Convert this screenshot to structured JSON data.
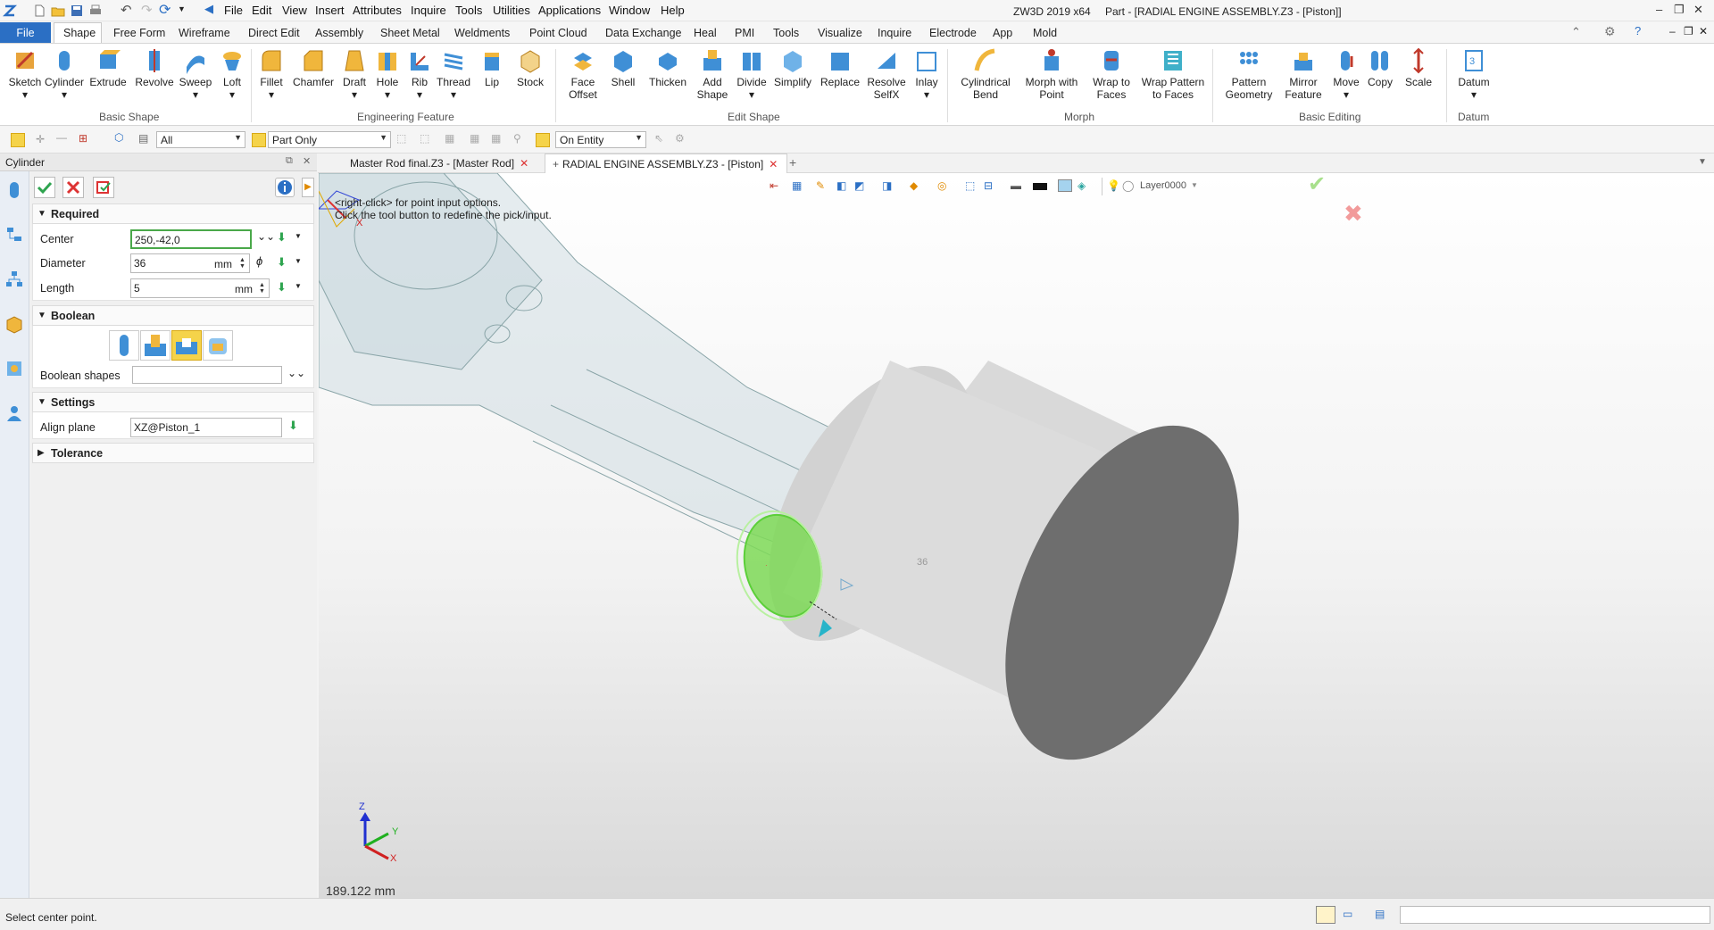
{
  "menu": [
    "File",
    "Edit",
    "View",
    "Insert",
    "Attributes",
    "Inquire",
    "Tools",
    "Utilities",
    "Applications",
    "Window",
    "Help"
  ],
  "app_title": "ZW3D 2019  x64",
  "doc_title": "Part - [RADIAL ENGINE ASSEMBLY.Z3 - [Piston]]",
  "ribbon_tabs": [
    "File",
    "Shape",
    "Free Form",
    "Wireframe",
    "Direct Edit",
    "Assembly",
    "Sheet Metal",
    "Weldments",
    "Point Cloud",
    "Data Exchange",
    "Heal",
    "PMI",
    "Tools",
    "Visualize",
    "Inquire",
    "Electrode",
    "App",
    "Mold"
  ],
  "ribbon": {
    "basic_shape": {
      "label": "Basic Shape",
      "buttons": [
        "Sketch",
        "Cylinder",
        "Extrude",
        "Revolve",
        "Sweep",
        "Loft"
      ]
    },
    "engineering_feature": {
      "label": "Engineering Feature",
      "buttons": [
        "Fillet",
        "Chamfer",
        "Draft",
        "Hole",
        "Rib",
        "Thread",
        "Lip",
        "Stock"
      ]
    },
    "edit_shape": {
      "label": "Edit Shape",
      "buttons": [
        "Face\nOffset",
        "Shell",
        "Thicken",
        "Add\nShape",
        "Divide",
        "Simplify",
        "Replace",
        "Resolve\nSelfX",
        "Inlay"
      ]
    },
    "morph": {
      "label": "Morph",
      "buttons": [
        "Cylindrical\nBend",
        "Morph with\nPoint",
        "Wrap to\nFaces",
        "Wrap Pattern\nto Faces"
      ]
    },
    "basic_editing": {
      "label": "Basic Editing",
      "buttons": [
        "Pattern\nGeometry",
        "Mirror\nFeature",
        "Move",
        "Copy",
        "Scale"
      ]
    },
    "datum": {
      "label": "Datum",
      "buttons": [
        "Datum"
      ]
    }
  },
  "toolbar": {
    "filter_all": "All",
    "part_only": "Part Only",
    "on_entity": "On Entity",
    "layer": "Layer0000"
  },
  "panel": {
    "title": "Cylinder",
    "required": "Required",
    "center_label": "Center",
    "center_value": "250,-42,0",
    "diameter_label": "Diameter",
    "diameter_value": "36",
    "diameter_unit": "mm",
    "length_label": "Length",
    "length_value": "5",
    "length_unit": "mm",
    "boolean": "Boolean",
    "boolean_shapes_label": "Boolean shapes",
    "settings": "Settings",
    "align_plane_label": "Align plane",
    "align_plane_value": "XZ@Piston_1",
    "tolerance": "Tolerance"
  },
  "doc_tabs": [
    "Master Rod final.Z3 - [Master Rod]",
    "RADIAL ENGINE ASSEMBLY.Z3 - [Piston]"
  ],
  "viewport": {
    "hint1": "<right-click> for point input options.",
    "hint2": "Click the tool button to redefine the pick/input.",
    "measure": "189.122 mm",
    "dim_label": "36"
  },
  "status": "Select center point.",
  "colors": {
    "accent": "#2b6fc4",
    "highlight": "#7ed957"
  }
}
